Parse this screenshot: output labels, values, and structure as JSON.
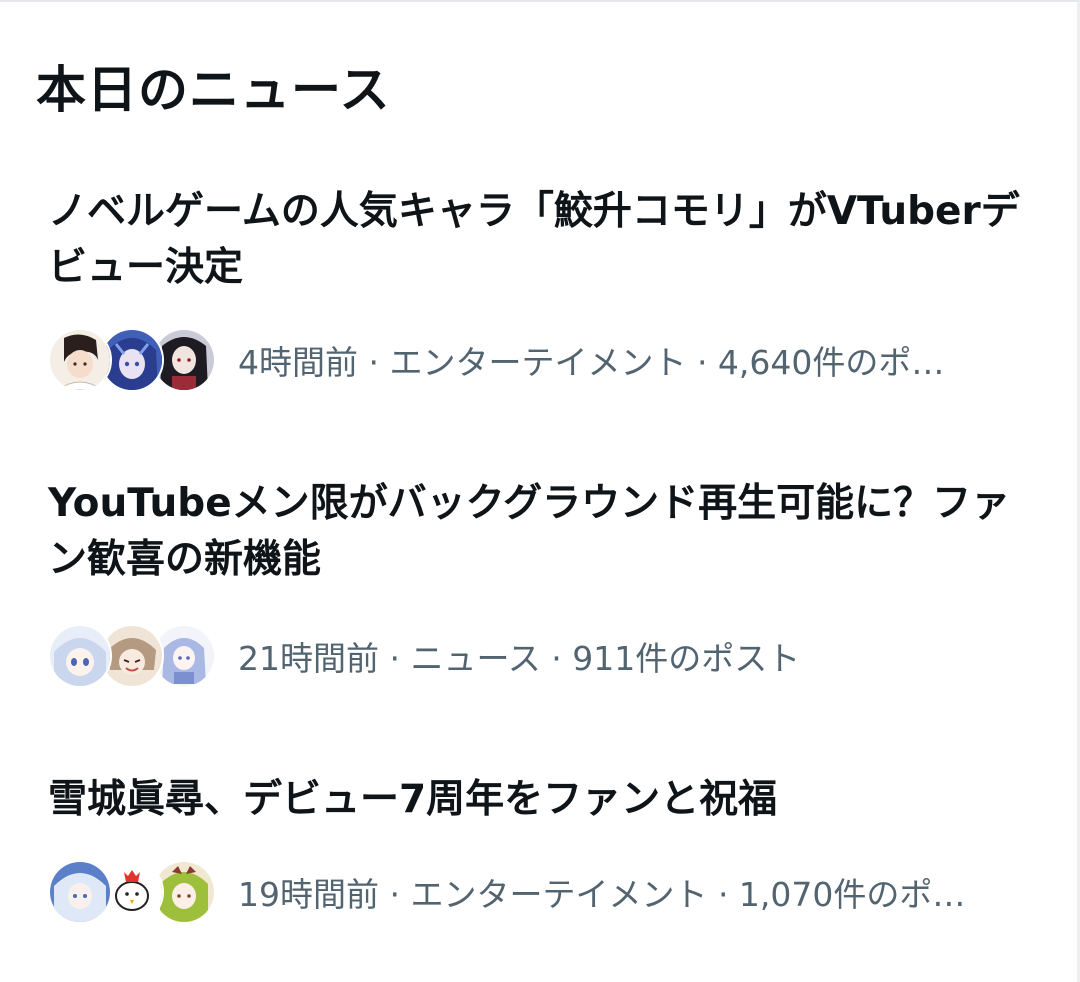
{
  "section": {
    "title": "本日のニュース"
  },
  "news": [
    {
      "headline": "ノベルゲームの人気キャラ「鮫升コモリ」がVTuberデビュー決定",
      "meta": "4時間前 · エンターテイメント · 4,640件のポ…"
    },
    {
      "headline": "YouTubeメン限がバックグラウンド再生可能に？ファン歓喜の新機能",
      "meta": "21時間前 · ニュース · 911件のポスト"
    },
    {
      "headline": "雪城眞尋、デビュー7周年をファンと祝福",
      "meta": "19時間前 · エンターテイメント · 1,070件のポ…"
    }
  ]
}
